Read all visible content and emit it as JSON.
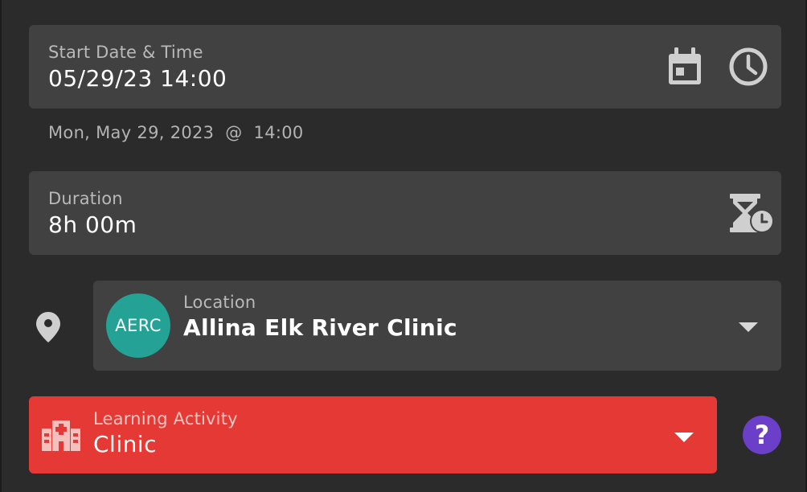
{
  "start": {
    "label": "Start Date & Time",
    "value": "05/29/23 14:00",
    "calendar_icon": "calendar-icon",
    "clock_icon": "clock-icon",
    "helper_text": "Mon, May 29, 2023  @  14:00"
  },
  "duration": {
    "label": "Duration",
    "value": "8h 00m",
    "icon": "hourglass-clock-icon"
  },
  "location": {
    "pin_icon": "location-pin-icon",
    "avatar_text": "AERC",
    "avatar_color": "#24a295",
    "label": "Location",
    "value": "Allina Elk River Clinic",
    "dropdown_icon": "chevron-down-icon"
  },
  "learning_activity": {
    "label": "Learning Activity",
    "value": "Clinic",
    "icon": "hospital-icon",
    "dropdown_icon": "chevron-down-icon",
    "color": "#e53935"
  },
  "help": {
    "label": "?",
    "color": "#6b3fc7"
  }
}
